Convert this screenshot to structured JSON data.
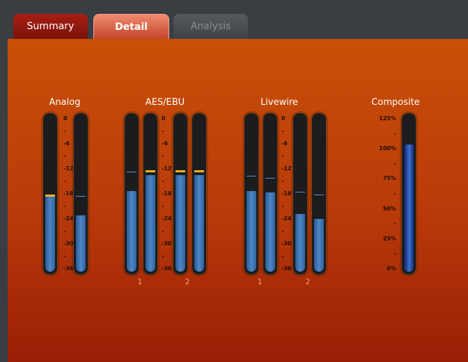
{
  "tabs": [
    {
      "label": "Summary"
    },
    {
      "label": "Detail"
    },
    {
      "label": "Analysis"
    }
  ],
  "groups": {
    "analog": {
      "label": "Analog"
    },
    "aes_ebu": {
      "label": "AES/EBU",
      "channels": [
        "1",
        "2"
      ]
    },
    "livewire": {
      "label": "Livewire",
      "channels": [
        "1",
        "2"
      ]
    },
    "composite": {
      "label": "Composite"
    }
  },
  "db_scale": [
    "0",
    "–",
    "-6",
    "–",
    "-12",
    "–",
    "-18",
    "–",
    "-24",
    "–",
    "-30",
    "–",
    "-36"
  ],
  "composite_scale": [
    "125%",
    "–",
    "100%",
    "–",
    "75%",
    "–",
    "50%",
    "–",
    "25%",
    "–",
    "0%"
  ],
  "levels": {
    "analog": [
      {
        "fraction": 0.48,
        "peak": 0.48
      },
      {
        "fraction": 0.36,
        "peak": 0.48
      }
    ],
    "aes_ebu": [
      {
        "fraction": 0.52,
        "peak": 0.64
      },
      {
        "fraction": 0.62,
        "peak": 0.64
      },
      {
        "fraction": 0.62,
        "peak": 0.64
      },
      {
        "fraction": 0.62,
        "peak": 0.64
      }
    ],
    "livewire": [
      {
        "fraction": 0.52,
        "peak": 0.61
      },
      {
        "fraction": 0.51,
        "peak": 0.6
      },
      {
        "fraction": 0.37,
        "peak": 0.51
      },
      {
        "fraction": 0.34,
        "peak": 0.49
      }
    ],
    "composite_percent": 102
  },
  "colors": {
    "panel": "#c95008",
    "meter_fill": "#4d86c6",
    "peak": "#f3b51e",
    "active_tab": "#e07050"
  }
}
